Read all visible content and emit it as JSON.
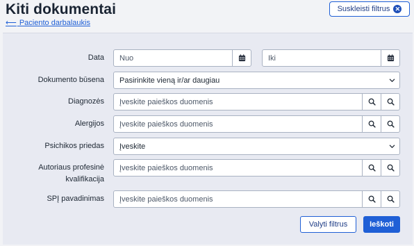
{
  "header": {
    "title": "Kiti dokumentai",
    "back_arrow": "⟵",
    "back_link": "Paciento darbalaukis",
    "collapse_label": "Suskleisti filtrus"
  },
  "filters": {
    "date": {
      "label": "Data",
      "from_placeholder": "Nuo",
      "to_placeholder": "Iki"
    },
    "status": {
      "label": "Dokumento būsena",
      "value": "Pasirinkite vieną ir/ar daugiau"
    },
    "diagnoses": {
      "label": "Diagnozės",
      "placeholder": "Įveskite paieškos duomenis"
    },
    "allergies": {
      "label": "Alergijos",
      "placeholder": "Įveskite paieškos duomenis"
    },
    "psych": {
      "label": "Psichikos priedas",
      "value": "Įveskite"
    },
    "author": {
      "label_line1": "Autoriaus profesinė",
      "label_line2": "kvalifikacija",
      "placeholder": "Įveskite paieškos duomenis"
    },
    "spi": {
      "label": "SPĮ pavadinimas",
      "placeholder": "Įveskite paieškos duomenis"
    }
  },
  "actions": {
    "clear_label": "Valyti filtrus",
    "search_label": "Ieškoti"
  },
  "icons": [
    "calendar-icon",
    "search-icon",
    "chevron-down-icon",
    "close-circle-icon"
  ],
  "colors": {
    "accent": "#1f5fd6",
    "panel": "#e8eaf2",
    "page_bg": "#f2f3f6"
  }
}
